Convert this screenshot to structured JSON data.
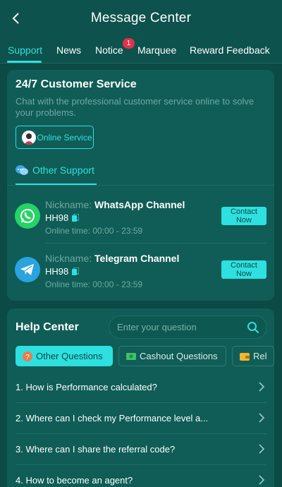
{
  "header": {
    "title": "Message Center"
  },
  "tabs": [
    {
      "label": "Support"
    },
    {
      "label": "News"
    },
    {
      "label": "Notice",
      "badge": "1"
    },
    {
      "label": "Marquee"
    },
    {
      "label": "Reward Feedback"
    }
  ],
  "customer_service": {
    "title": "24/7 Customer Service",
    "description": "Chat with the professional customer service online to solve your problems.",
    "online_button": "Online Service",
    "other_support_label": "Other Support",
    "channels": [
      {
        "nickname_label": "Nickname:",
        "name": "WhatsApp Channel",
        "id": "HH98",
        "time_label": "Online time:",
        "time": "00:00 - 23:59",
        "contact_label": "Contact Now",
        "icon": "whatsapp-icon",
        "color": "#25d366"
      },
      {
        "nickname_label": "Nickname:",
        "name": "Telegram Channel",
        "id": "HH98",
        "time_label": "Online time:",
        "time": "00:00 - 23:59",
        "contact_label": "Contact Now",
        "icon": "telegram-icon",
        "color": "#2aa3df"
      }
    ]
  },
  "help_center": {
    "title": "Help Center",
    "search_placeholder": "Enter your question",
    "categories": [
      {
        "label": "Other Questions",
        "icon": "question-icon",
        "active": true
      },
      {
        "label": "Cashout Questions",
        "icon": "cash-icon",
        "active": false
      },
      {
        "label": "Rel",
        "icon": "wallet-icon",
        "active": false
      }
    ],
    "faqs": [
      "1. How is Performance calculated?",
      "2. Where can I check my Performance level a...",
      "3. Where can I share the referral code?",
      "4. How to become an agent?"
    ]
  },
  "colors": {
    "accent": "#2ee0e0",
    "background": "#0b4a45",
    "card": "#0f5d56",
    "badge": "#e2324a"
  }
}
